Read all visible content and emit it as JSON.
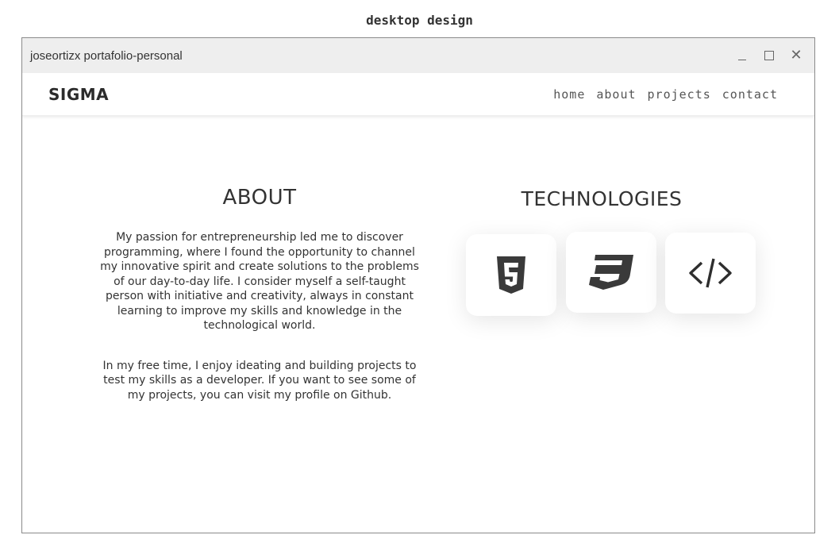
{
  "caption": "desktop design",
  "window": {
    "title": "joseortizx portafolio-personal",
    "controls": {
      "minimize_icon": "minimize-icon",
      "maximize_icon": "maximize-icon",
      "close_icon": "close-icon"
    }
  },
  "navbar": {
    "logo": "SIGMA",
    "links": [
      "home",
      "about",
      "projects",
      "contact"
    ]
  },
  "about": {
    "heading": "ABOUT",
    "paragraphs": [
      "My passion for entrepreneurship led me to discover programming, where I found the opportunity to channel my innovative spirit and create solutions to the problems of our day-to-day life. I consider myself a self-taught person with initiative and creativity, always in constant learning to improve my skills and knowledge in the technological world.",
      "In my free time, I enjoy ideating and building projects to test my skills as a developer. If you want to see some of my projects, you can visit my profile on Github."
    ]
  },
  "technologies": {
    "heading": "TECHNOLOGIES",
    "icons": [
      "html5-icon",
      "css3-icon",
      "code-icon"
    ]
  },
  "colors": {
    "titlebar": "#eeeeee",
    "icon_fill": "#3a3a3a",
    "text": "#333333"
  }
}
